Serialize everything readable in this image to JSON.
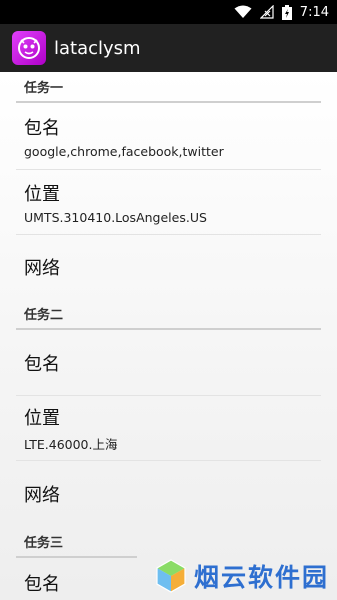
{
  "status": {
    "time": "7:14"
  },
  "app": {
    "title": "lataclysm"
  },
  "tasks": [
    {
      "header": "任务一",
      "items": [
        {
          "title": "包名",
          "summary": "google,chrome,facebook,twitter"
        },
        {
          "title": "位置",
          "summary": "UMTS.310410.LosAngeles.US"
        },
        {
          "title": "网络",
          "summary": ""
        }
      ]
    },
    {
      "header": "任务二",
      "items": [
        {
          "title": "包名",
          "summary": ""
        },
        {
          "title": "位置",
          "summary": "LTE.46000.上海"
        },
        {
          "title": "网络",
          "summary": ""
        }
      ]
    },
    {
      "header": "任务三",
      "items": [
        {
          "title": "包名",
          "summary": ""
        }
      ]
    }
  ],
  "watermark": {
    "text": "烟云软件园"
  }
}
